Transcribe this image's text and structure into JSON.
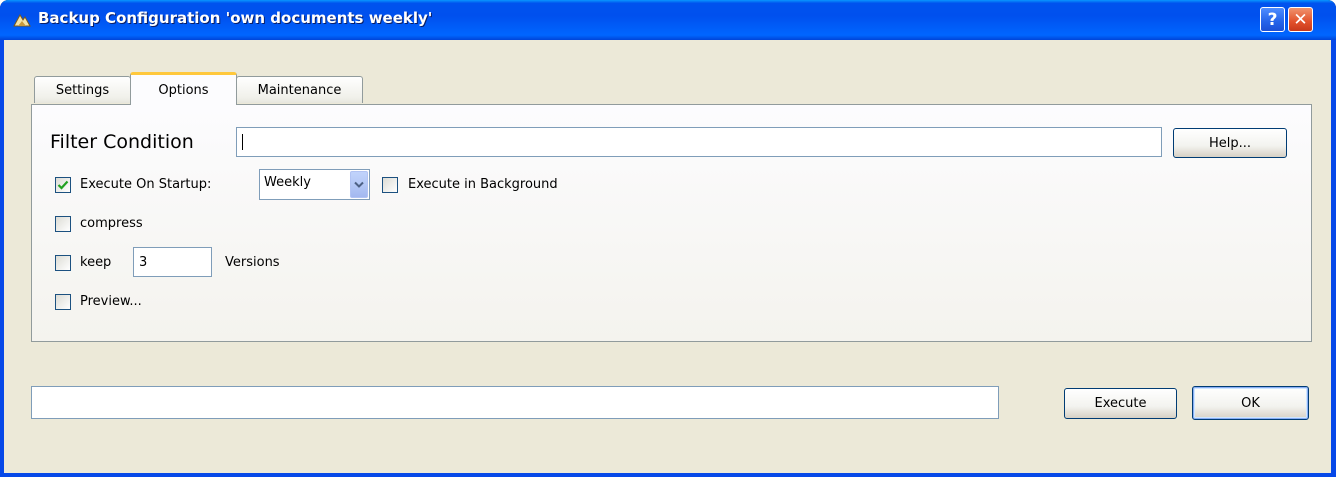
{
  "window": {
    "title": "Backup Configuration 'own documents weekly'",
    "help_glyph": "?",
    "close_glyph": "✕"
  },
  "tabs": [
    {
      "label": "Settings",
      "active": false
    },
    {
      "label": "Options",
      "active": true
    },
    {
      "label": "Maintenance",
      "active": false
    }
  ],
  "options": {
    "filter_label": "Filter Condition",
    "filter_value": "",
    "help_button": "Help...",
    "execute_on_startup": {
      "label": "Execute On Startup:",
      "checked": true
    },
    "frequency": {
      "selected": "Weekly"
    },
    "execute_in_background": {
      "label": "Execute in Background",
      "checked": false
    },
    "compress": {
      "label": "compress",
      "checked": false
    },
    "keep": {
      "label": "keep",
      "checked": false,
      "count": "3",
      "suffix": "Versions"
    },
    "preview": {
      "label": "Preview...",
      "checked": false
    }
  },
  "footer": {
    "status_value": "",
    "execute_button": "Execute",
    "ok_button": "OK"
  },
  "icons": {
    "title": "backup-app-icon",
    "check": "check-mark-icon",
    "dropdown": "chevron-down-icon"
  },
  "colors": {
    "titlebar": "#0054e3",
    "client": "#ece9d8",
    "active_tab_accent": "#ffc83c",
    "check_mark": "#21a121"
  }
}
